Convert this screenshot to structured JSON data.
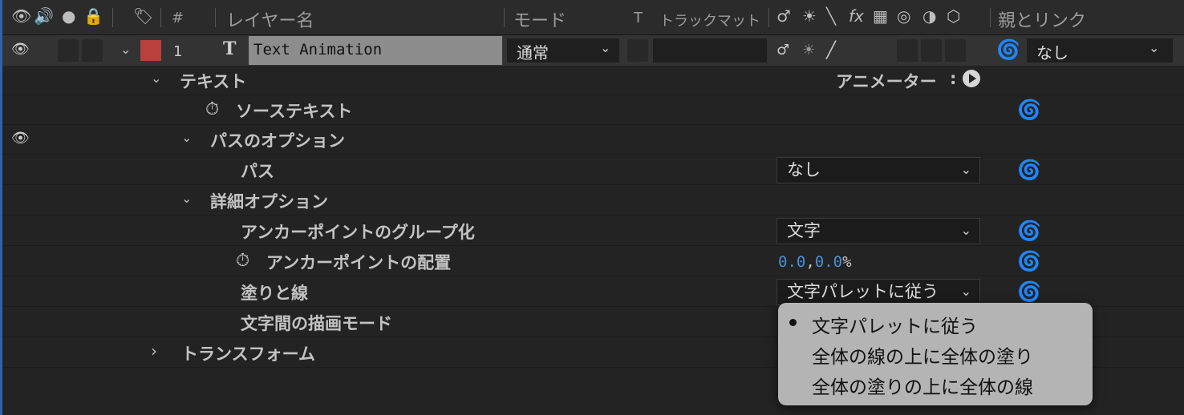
{
  "header": {
    "layer_name": "レイヤー名",
    "mode": "モード",
    "t": "T",
    "track_matte": "トラックマット",
    "parent_link": "親とリンク",
    "hash": "#"
  },
  "layer": {
    "number": "1",
    "type_icon": "T",
    "name": "Text Animation",
    "mode": "通常",
    "parent": "なし",
    "color": "#b8403d"
  },
  "props": {
    "text": "テキスト",
    "animator": "アニメーター",
    "animator_sep": ":",
    "source_text": "ソーステキスト",
    "path_options": "パスのオプション",
    "path": "パス",
    "path_value": "なし",
    "more_options": "詳細オプション",
    "anchor_grouping": "アンカーポイントのグループ化",
    "anchor_grouping_value": "文字",
    "grouping_alignment": "アンカーポイントの配置",
    "grouping_alignment_x": "0.0",
    "grouping_alignment_comma": ",",
    "grouping_alignment_y": "0.0",
    "grouping_alignment_unit": "%",
    "fill_stroke": "塗りと線",
    "fill_stroke_value": "文字パレットに従う",
    "blend_mode": "文字間の描画モード",
    "transform": "トランスフォーム"
  },
  "popup": {
    "items": [
      "文字パレットに従う",
      "全体の線の上に全体の塗り",
      "全体の塗りの上に全体の線"
    ],
    "selected_index": 0
  },
  "colors": {
    "value_blue": "#4a8fd8",
    "popup_bg": "#b4b4b4"
  }
}
